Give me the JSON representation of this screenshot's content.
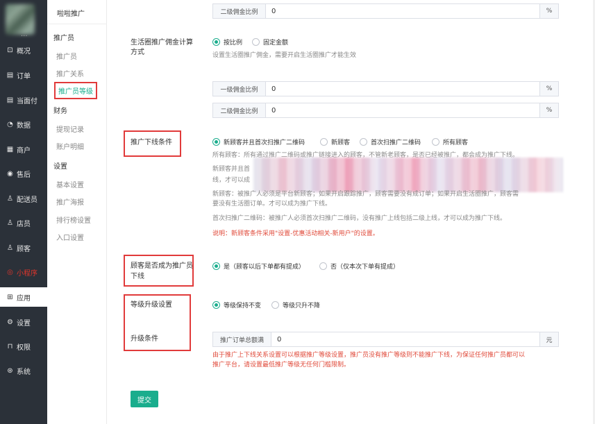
{
  "sidebar": {
    "logo_suffix": "...",
    "items": [
      {
        "label": "概况",
        "icon": "overview-icon",
        "glyph": "⊡"
      },
      {
        "label": "订单",
        "icon": "order-icon",
        "glyph": "▤"
      },
      {
        "label": "当面付",
        "icon": "pay-icon",
        "glyph": "▤"
      },
      {
        "label": "数据",
        "icon": "data-icon",
        "glyph": "◔"
      },
      {
        "label": "商户",
        "icon": "store-icon",
        "glyph": "▦"
      },
      {
        "label": "售后",
        "icon": "aftersale-icon",
        "glyph": "◉"
      },
      {
        "label": "配送员",
        "icon": "courier-icon",
        "glyph": "♙"
      },
      {
        "label": "店员",
        "icon": "clerk-icon",
        "glyph": "♙"
      },
      {
        "label": "顾客",
        "icon": "customer-icon",
        "glyph": "♙"
      },
      {
        "label": "小程序",
        "icon": "miniapp-icon",
        "glyph": "◎"
      },
      {
        "label": "应用",
        "icon": "apps-icon",
        "glyph": "⊞"
      },
      {
        "label": "设置",
        "icon": "settings-icon",
        "glyph": "⚙"
      },
      {
        "label": "权限",
        "icon": "lock-icon",
        "glyph": "⊓"
      },
      {
        "label": "系统",
        "icon": "system-icon",
        "glyph": "⊛"
      }
    ]
  },
  "subnav": {
    "title": "啦啦推广",
    "groups": {
      "promoter": "推广员",
      "finance": "财务",
      "settings": "设置"
    },
    "items": {
      "promoter": "推广员",
      "relation": "推广关系",
      "level": "推广员等级",
      "withdraw": "提现记录",
      "ledger": "账户明细",
      "basic": "基本设置",
      "poster": "推广海报",
      "ranking": "排行榜设置",
      "entry": "入口设置"
    }
  },
  "form": {
    "top_input": {
      "prefix": "二级佣金比例",
      "value": "0",
      "suffix": "%"
    },
    "life_circle": {
      "label_line1": "生活圈推广佣金计算",
      "label_line2": "方式",
      "opt_ratio": "按比例",
      "opt_fixed": "固定金额",
      "hint": "设置生活圈推广佣金，需要开启生活圈推广才能生效",
      "level1": {
        "prefix": "一级佣金比例",
        "value": "0",
        "suffix": "%"
      },
      "level2": {
        "prefix": "二级佣金比例",
        "value": "0",
        "suffix": "%"
      }
    },
    "downline": {
      "label": "推广下线条件",
      "opt1": "新顾客并且首次扫推广二维码",
      "opt2": "新顾客",
      "opt3": "首次扫推广二维码",
      "opt4": "所有顾客",
      "desc_all": "所有顾客：所有通过推广二维码或推广链接进入的顾客，不管新老顾客，是否已经被推广，都会成为推广下线。",
      "desc_new_first_a": "新顾客并且首",
      "desc_new_first_b": "线，才可以成",
      "desc_new_1": "新顾客：被推广人必须是平台新顾客；如果开启跟踪推广，顾客需要没有成订单；如果开启生活圈推广，顾客需",
      "desc_new_2": "要没有生活圈订单。才可以成为推广下线。",
      "desc_first": "首次扫推广二维码：被推广人必须首次扫推广二维码，没有推广上线包括二级上线，才可以成为推广下线。",
      "note": "说明：新顾客条件采用\"设置-优惠活动相关-新用户\"的设置。"
    },
    "customer_promoter": {
      "label_line1": "顾客是否成为推广员",
      "label_line2": "下线",
      "opt_yes": "是（顾客以后下单都有提成）",
      "opt_no": "否（仅本次下单有提成）"
    },
    "upgrade": {
      "label": "等级升级设置",
      "opt_keep": "等级保持不变",
      "opt_only_up": "等级只升不降"
    },
    "condition": {
      "label": "升级条件",
      "prefix": "推广订单总额满",
      "value": "0",
      "suffix": "元",
      "warn_1": "由于推广上下线关系设置可以根据推广等级设置，推广员没有推广等级则不能推广下线，为保证任何推广员都可以",
      "warn_2": "推广平台，请设置最低推广等级无任何门槛限制。"
    },
    "submit": "提交"
  },
  "colors": {
    "primary": "#1aad8d",
    "sidebar_bg": "#2b3139",
    "highlight_box": "#e13a3a",
    "warn_text": "#e04a3a"
  }
}
